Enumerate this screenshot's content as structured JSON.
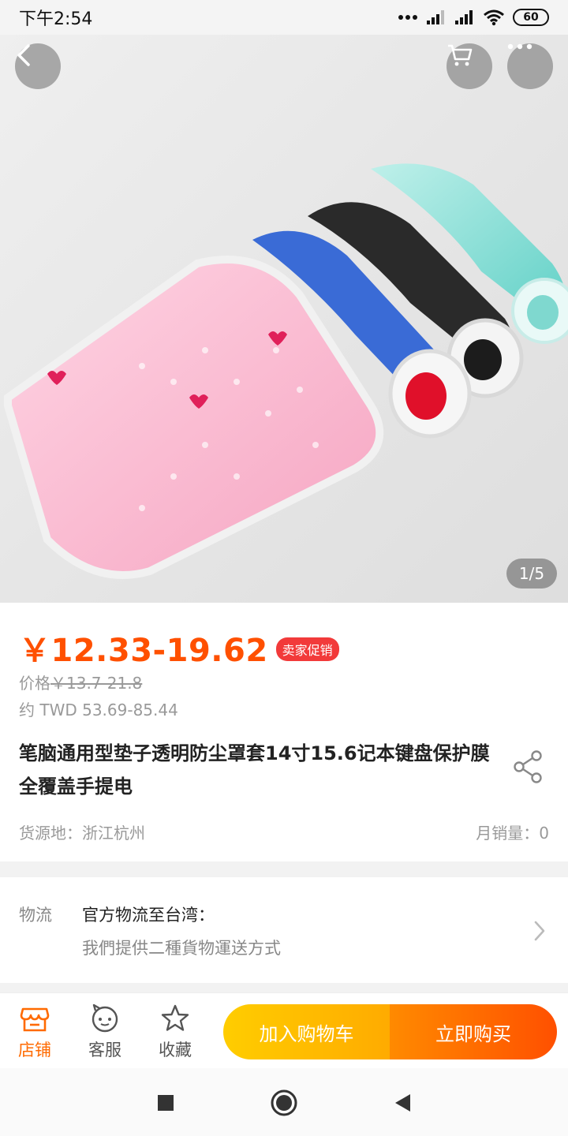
{
  "status_bar": {
    "time": "下午2:54",
    "battery": "60"
  },
  "gallery": {
    "counter": "1/5"
  },
  "product": {
    "price": "￥12.33-19.62",
    "promo_badge": "卖家促销",
    "orig_price_label": "价格",
    "orig_price": "￥13.7-21.8",
    "approx_price": "约 TWD 53.69-85.44",
    "title": "笔脑通用型垫子透明防尘罩套14寸15.6记本键盘保护膜全覆盖手提电",
    "origin": "货源地：浙江杭州",
    "monthly_sales": "月销量：0"
  },
  "logistics": {
    "label": "物流",
    "main": "官方物流至台湾：",
    "sub": "我們提供二種貨物運送方式"
  },
  "action_bar": {
    "store": "店铺",
    "service": "客服",
    "favorite": "收藏",
    "add_to_cart": "加入购物车",
    "buy_now": "立即购买"
  },
  "colors": {
    "accent": "#ff5000",
    "promo": "#f23a3a",
    "cart_start": "#ffcd00",
    "buy_end": "#ff5000"
  }
}
